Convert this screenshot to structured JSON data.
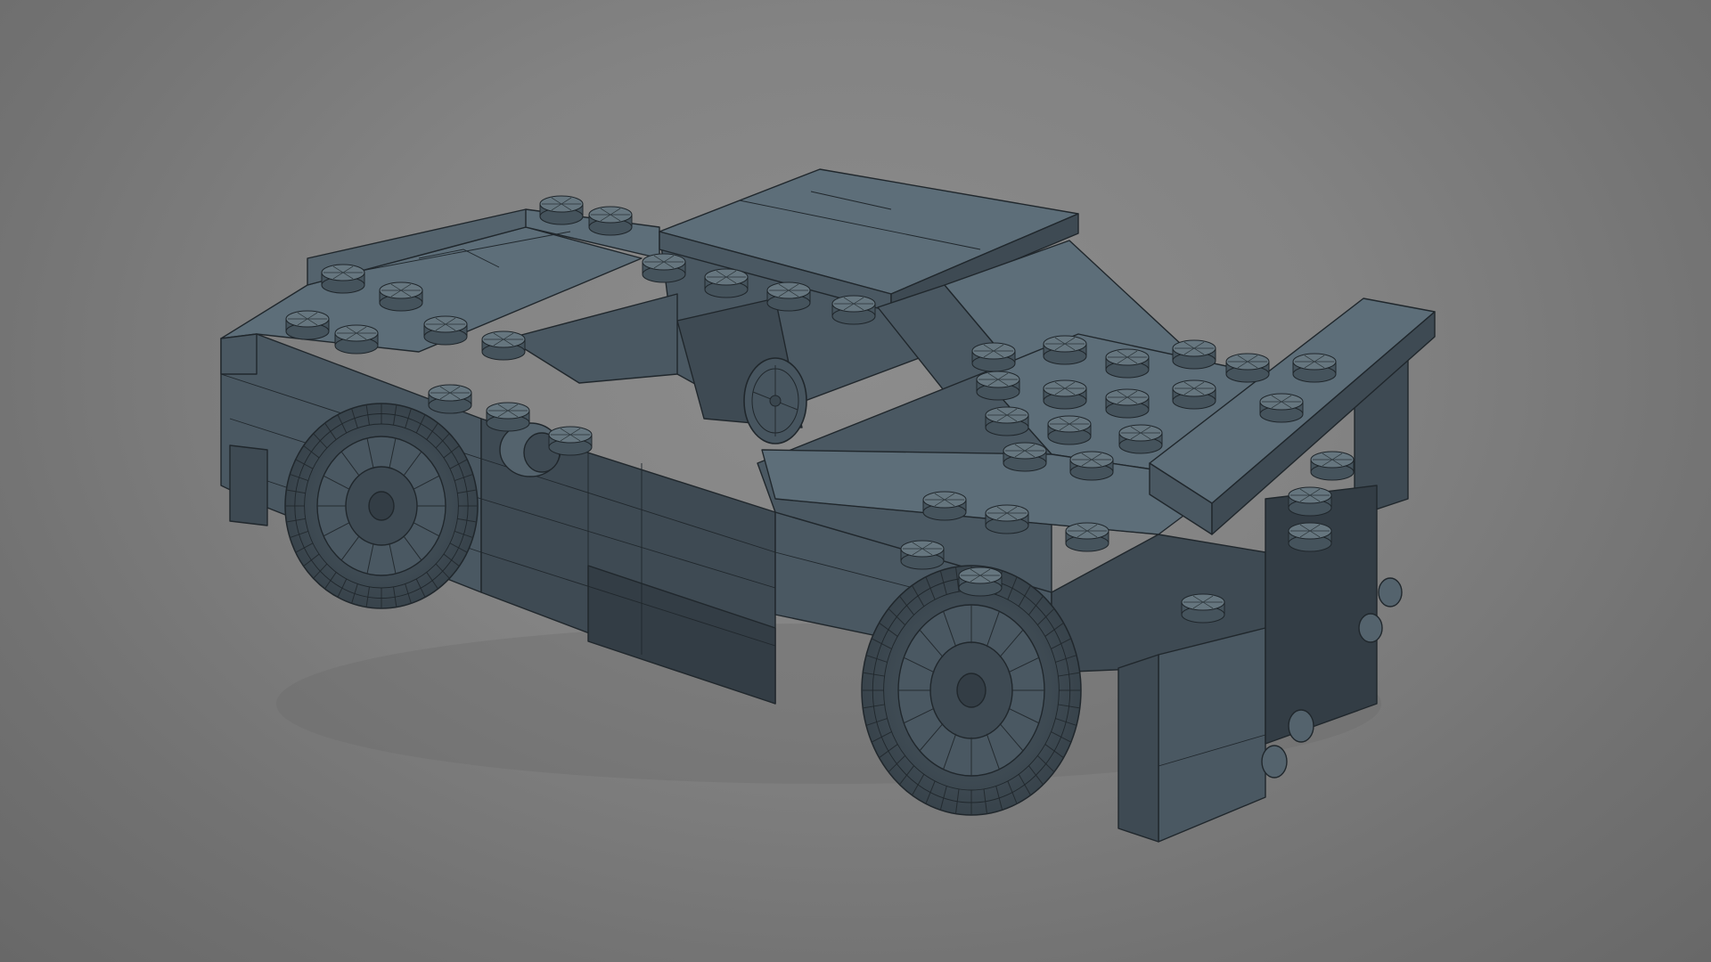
{
  "scene": {
    "subject": "brick-car-model",
    "render_style": "wireframe-on-shaded",
    "colors": {
      "background_center": "#8c8c8c",
      "background_edge": "#686868",
      "model_top": "#5d6e79",
      "model_side": "#4a5862",
      "model_shadow": "#333d45",
      "wire": "#20272c"
    },
    "visible_parts": [
      "roof",
      "hood",
      "rear-wing",
      "rear-deck",
      "steering-wheel",
      "rear-wheel",
      "front-wheel",
      "tail-lights",
      "side-skirt",
      "front-bumper"
    ]
  }
}
